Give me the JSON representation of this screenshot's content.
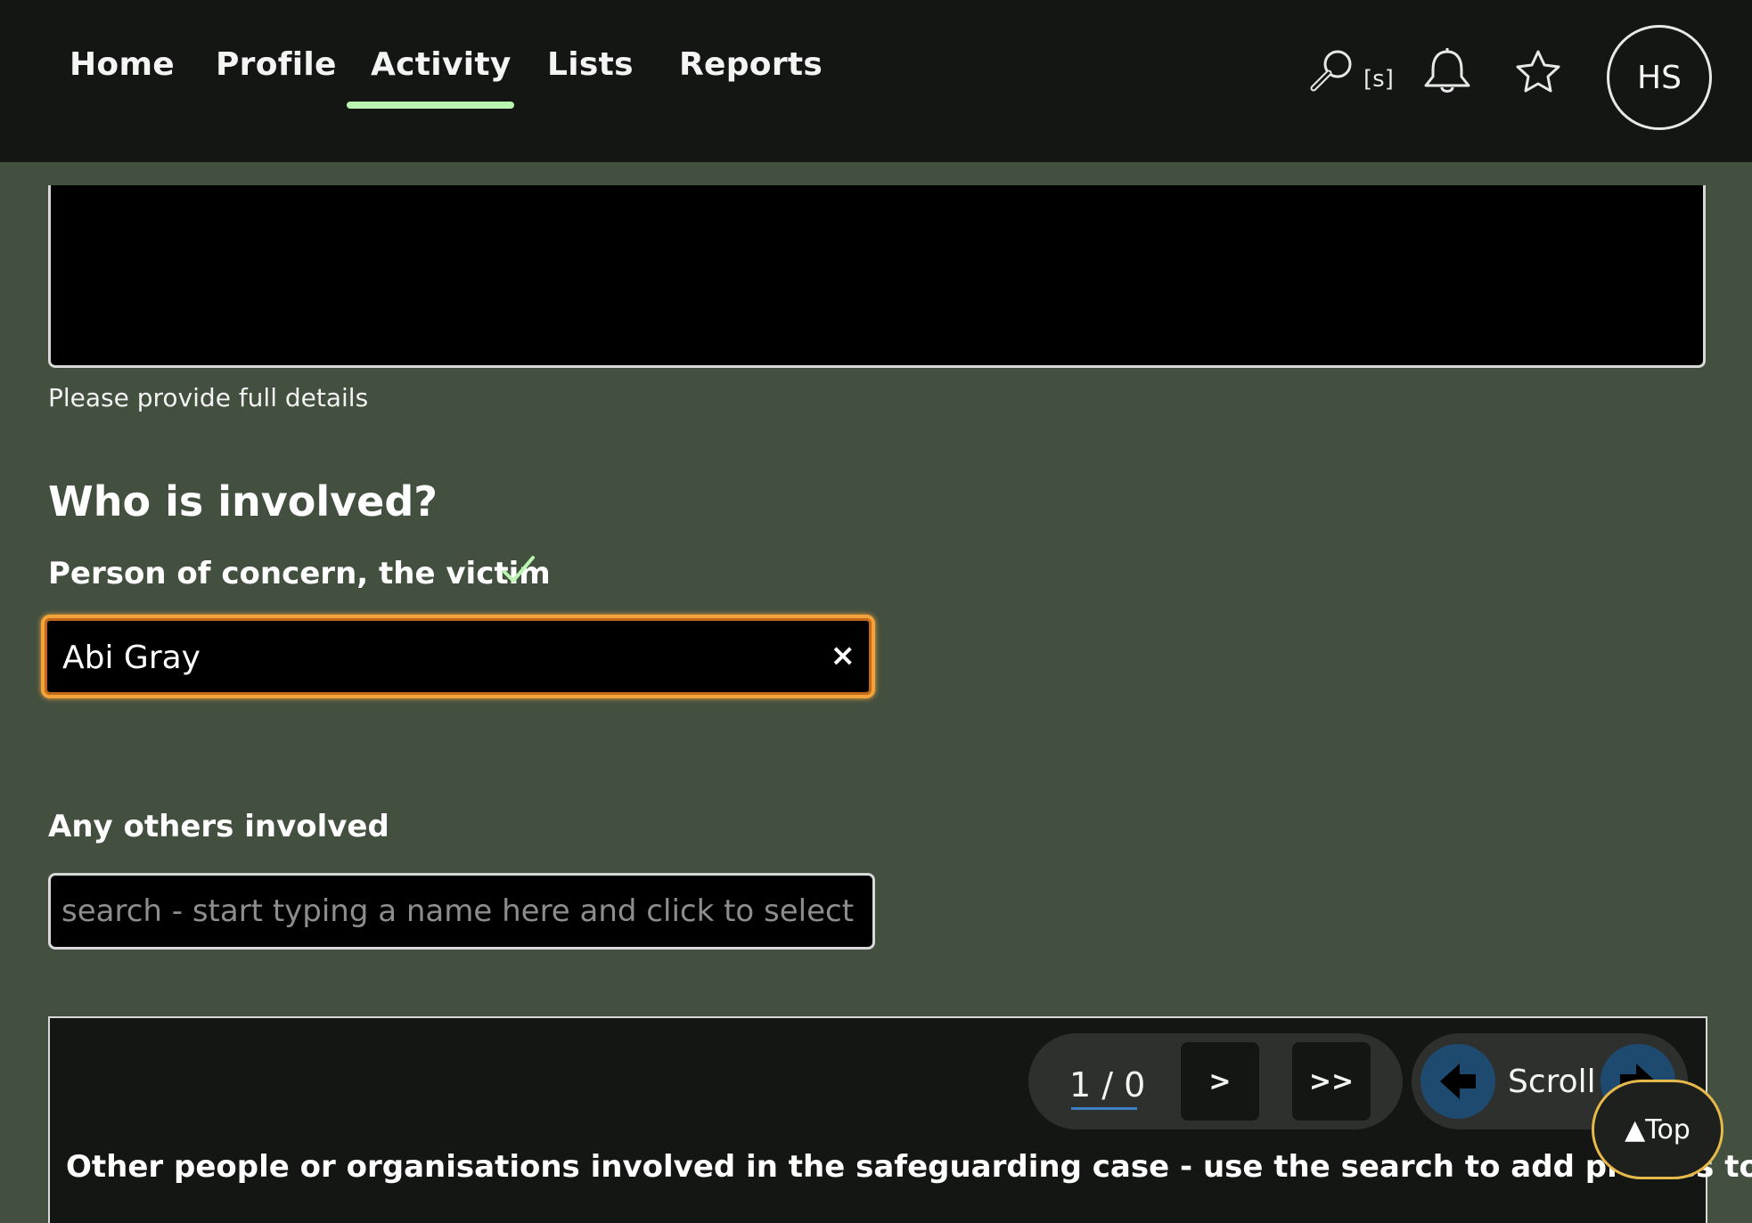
{
  "nav": {
    "items": [
      {
        "label": "Home"
      },
      {
        "label": "Profile"
      },
      {
        "label": "Activity"
      },
      {
        "label": "Lists"
      },
      {
        "label": "Reports"
      }
    ],
    "active": "Activity",
    "search_shortcut": "[s]",
    "avatar_initials": "HS",
    "icons": [
      "search-icon",
      "bell-icon",
      "star-icon"
    ],
    "active_underline_color": "#b9f5b0"
  },
  "details": {
    "help_text": "Please provide full details"
  },
  "involved": {
    "heading": "Who is involved?",
    "victim_label": "Person of concern, the victim",
    "victim_value": "Abi Gray",
    "clear_symbol": "×",
    "others_label": "Any others involved",
    "others_placeholder": "search - start typing a name here and click to select",
    "focus_color": "#f3a33a",
    "check_color": "#b9f5b0"
  },
  "table": {
    "pager_count": "1 / 0",
    "next_label": ">",
    "last_label": ">>",
    "scroll_label": "Scroll",
    "caption": "Other people or organisations involved in the safeguarding case - use the search to add profiles to it."
  },
  "top_button": {
    "label": "▲Top"
  }
}
